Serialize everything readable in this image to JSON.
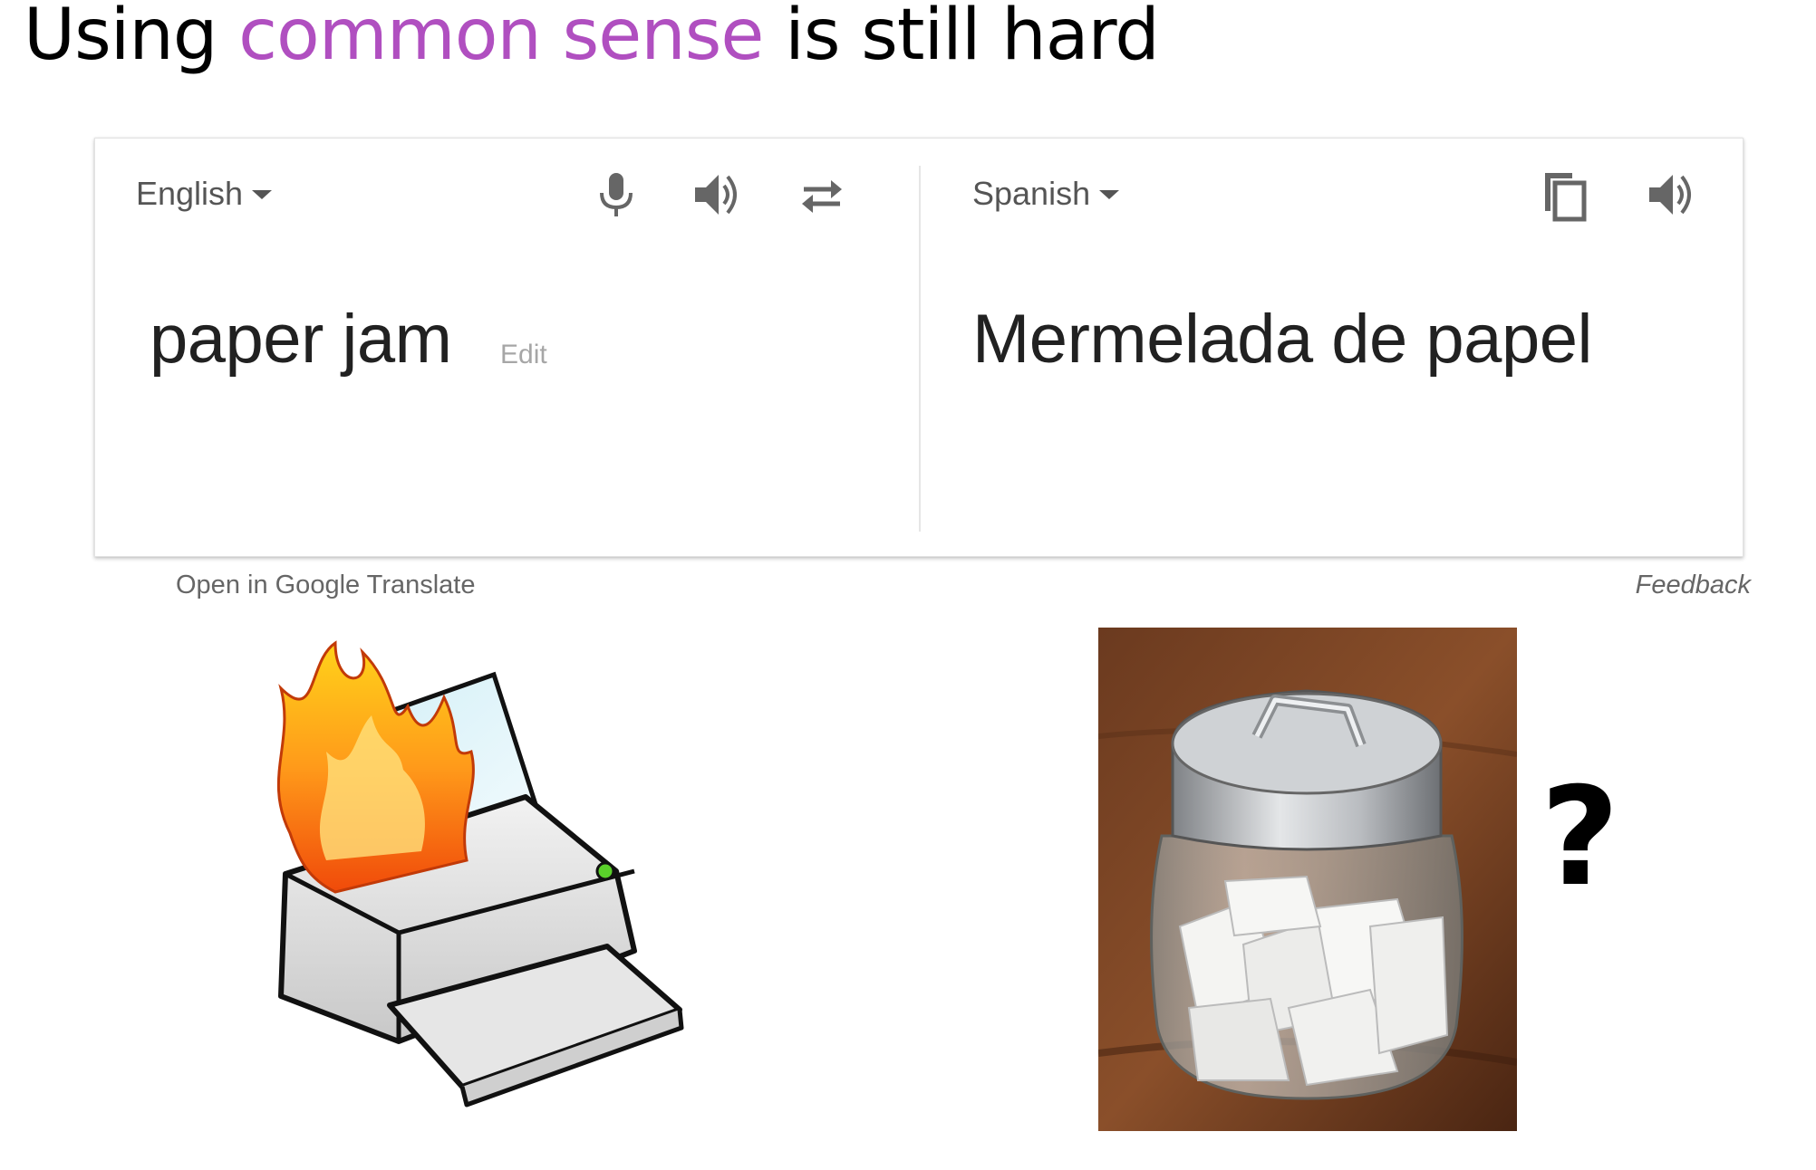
{
  "slide": {
    "title_prefix": "Using ",
    "title_highlight": "common sense",
    "title_suffix": " is still hard",
    "highlight_color": "#b04fc0"
  },
  "translate": {
    "source_language": "English",
    "target_language": "Spanish",
    "source_text": "paper jam",
    "edit_label": "Edit",
    "target_text": "Mermelada de papel",
    "source_icons": [
      "microphone-icon",
      "speaker-icon",
      "swap-icon"
    ],
    "target_icons": [
      "copy-icon",
      "speaker-icon"
    ],
    "open_link": "Open in Google Translate",
    "feedback_link": "Feedback"
  },
  "illustrations": {
    "left": "printer-on-fire",
    "right": "jar-of-paper-scraps",
    "question_mark": "?"
  }
}
